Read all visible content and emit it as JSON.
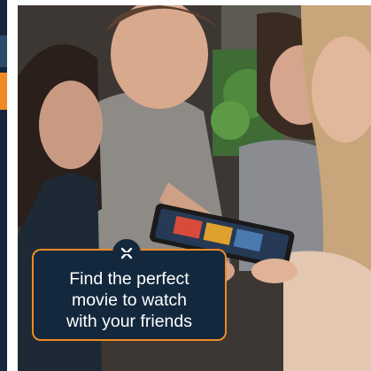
{
  "caption": {
    "text": "Find the perfect\nmovie to watch\nwith your friends"
  },
  "badge": {
    "icon": "x-logo-icon"
  },
  "colors": {
    "card_bg": "#13283d",
    "accent": "#f08a24",
    "text": "#ffffff"
  }
}
